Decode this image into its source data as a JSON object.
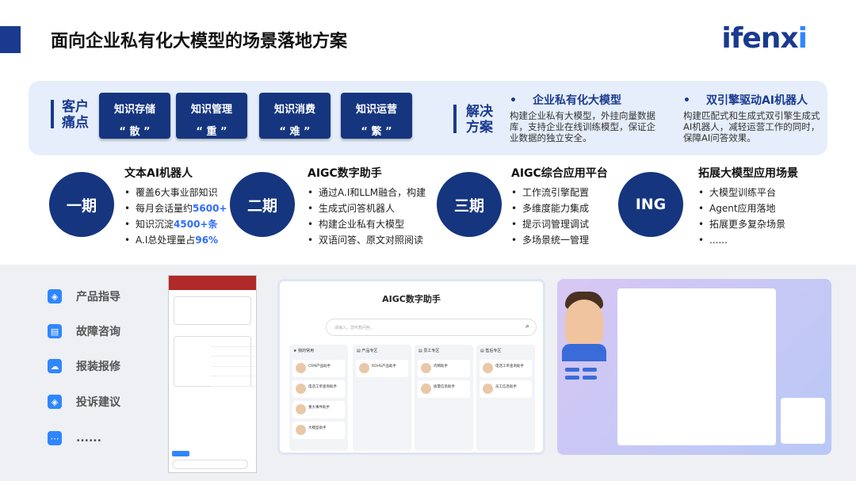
{
  "header": {
    "title": "面向企业私有化大模型的场景落地方案",
    "logo_main": "ifenx",
    "logo_tail": "i"
  },
  "pain": {
    "tag1": "客户",
    "tag2": "痛点",
    "items": [
      {
        "title": "知识存储",
        "sub": "“ 散 ”"
      },
      {
        "title": "知识管理",
        "sub": "“ 重 ”"
      },
      {
        "title": "知识消费",
        "sub": "“ 难 ”"
      },
      {
        "title": "知识运营",
        "sub": "“ 繁 ”"
      }
    ]
  },
  "solution": {
    "tag1": "解决",
    "tag2": "方案",
    "items": [
      {
        "bullet": "•",
        "title": "企业私有化大模型",
        "desc": "构建企业私有大模型，外挂向量数据库，支持企业在线训练模型，保证企业数据的独立安全。"
      },
      {
        "bullet": "•",
        "title": "双引擎驱动AI机器人",
        "desc": "构建匹配式和生成式双引擎生成式AI机器人，减轻运营工作的同时，保障AI问答效果。"
      }
    ]
  },
  "phases": [
    {
      "label": "一期",
      "title": "文本AI机器人",
      "items": [
        [
          "覆盖6大事业部知识",
          ""
        ],
        [
          "每月会话量约",
          "5600+"
        ],
        [
          "知识沉淀",
          "4500+条"
        ],
        [
          "A.I总处理量占",
          "96%"
        ]
      ]
    },
    {
      "label": "二期",
      "title": "AIGC数字助手",
      "items": [
        [
          "通过A.I和LLM融合，构建",
          ""
        ],
        [
          "生成式问答机器人",
          ""
        ],
        [
          "构建企业私有大模型",
          ""
        ],
        [
          "双语问答、原文对照阅读",
          ""
        ]
      ]
    },
    {
      "label": "三期",
      "title": "AIGC综合应用平台",
      "items": [
        [
          "工作流引擎配置",
          ""
        ],
        [
          "多维度能力集成",
          ""
        ],
        [
          "提示词管理调试",
          ""
        ],
        [
          "多场景统一管理",
          ""
        ]
      ]
    },
    {
      "label": "ING",
      "title": "拓展大模型应用场景",
      "items": [
        [
          "大模型训练平台",
          ""
        ],
        [
          "Agent应用落地",
          ""
        ],
        [
          "拓展更多复杂场景",
          ""
        ],
        [
          "......",
          ""
        ]
      ]
    }
  ],
  "services": [
    {
      "icon": "◈",
      "label": "产品指导"
    },
    {
      "icon": "▤",
      "label": "故障咨询"
    },
    {
      "icon": "☁",
      "label": "报装报修"
    },
    {
      "icon": "◈",
      "label": "投诉建议"
    },
    {
      "icon": "⋯",
      "label": "......"
    }
  ],
  "icons": {
    "service": [
      "guide-icon",
      "message-icon",
      "cloud-icon",
      "shield-icon",
      "more-icon"
    ]
  },
  "colors": {
    "primary": "#15357f",
    "accent": "#2f6bff",
    "band": "#e6eefb"
  },
  "assistant": {
    "brand": "AIGC数字助手",
    "search_placeholder": "请输入，您可想问些...",
    "columns": [
      {
        "name": "★ 我的常用",
        "items": [
          "CRM产品助手",
          "电话工单查询助手",
          "重大事件助手",
          "大模型助手"
        ]
      },
      {
        "name": "▤ 产品专区",
        "items": [
          "ROHS产品助手"
        ]
      },
      {
        "name": "▤ 员工专区",
        "items": [
          "内网助手",
          "质量信息助手"
        ]
      },
      {
        "name": "▤ 售后专区",
        "items": [
          "电话工单查询助手",
          "员工信息助手"
        ]
      }
    ]
  }
}
